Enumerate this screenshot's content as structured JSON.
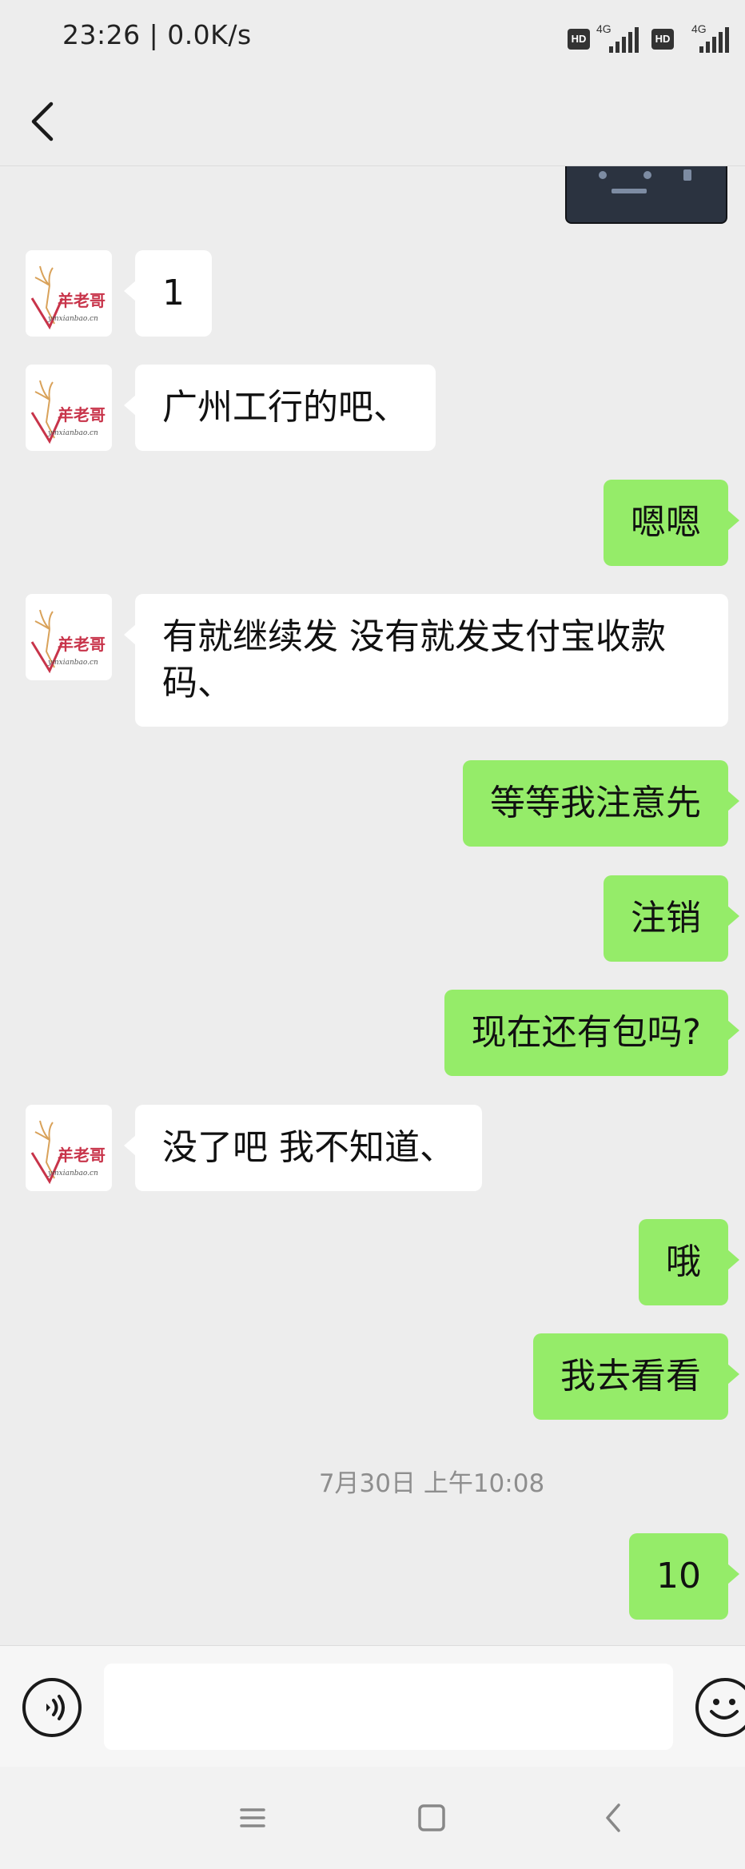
{
  "status_bar": {
    "time": "23:26 | 0.0K/s",
    "sim1": {
      "badge": "HD",
      "network": "4G"
    },
    "sim2": {
      "badge": "HD",
      "network": "4G"
    }
  },
  "header": {
    "back_icon": "chevron-left-icon"
  },
  "contact": {
    "avatar_text": "羊老哥",
    "avatar_subtext": "ymxianbao.cn"
  },
  "messages": [
    {
      "side": "right",
      "type": "image"
    },
    {
      "side": "left",
      "type": "text",
      "text": "1"
    },
    {
      "side": "left",
      "type": "text",
      "text": "广州工行的吧、"
    },
    {
      "side": "right",
      "type": "text",
      "text": "嗯嗯"
    },
    {
      "side": "left",
      "type": "text",
      "text": "有就继续发 没有就发支付宝收款码、"
    },
    {
      "side": "right",
      "type": "text",
      "text": "等等我注意先"
    },
    {
      "side": "right",
      "type": "text",
      "text": "注销"
    },
    {
      "side": "right",
      "type": "text",
      "text": "现在还有包吗?"
    },
    {
      "side": "left",
      "type": "text",
      "text": "没了吧 我不知道、"
    },
    {
      "side": "right",
      "type": "text",
      "text": "哦"
    },
    {
      "side": "right",
      "type": "text",
      "text": "我去看看"
    },
    {
      "type": "timestamp",
      "text": "7月30日 上午10:08"
    },
    {
      "side": "right",
      "type": "text",
      "text": "10"
    }
  ],
  "input_bar": {
    "voice_icon": "voice-icon",
    "input_value": "",
    "emoji_icon": "emoji-icon"
  },
  "nav_bar": {
    "menu_icon": "menu-icon",
    "home_icon": "home-icon",
    "back_icon": "back-icon"
  },
  "colors": {
    "background": "#ededed",
    "own_bubble": "#95ec69",
    "other_bubble": "#ffffff",
    "timestamp_text": "#8e8e8e"
  }
}
